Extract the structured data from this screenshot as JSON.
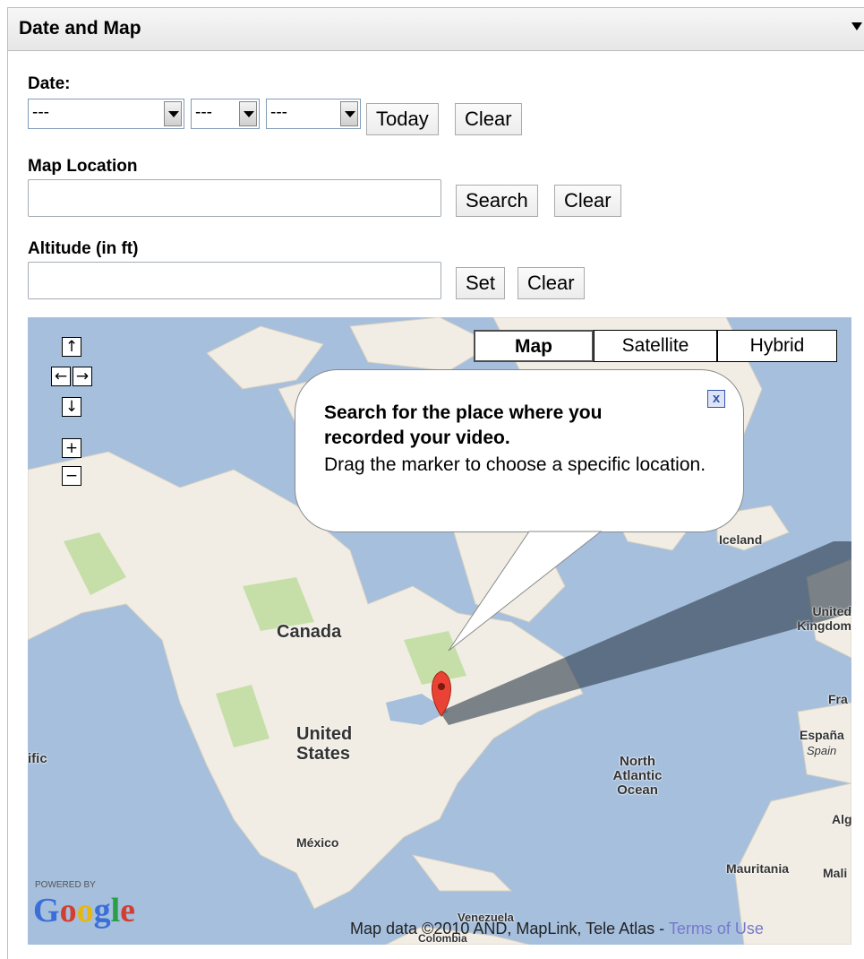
{
  "panel": {
    "title": "Date and Map"
  },
  "date": {
    "label": "Date:",
    "month": "---",
    "day": "---",
    "year": "---",
    "today_label": "Today",
    "clear_label": "Clear"
  },
  "location": {
    "label": "Map Location",
    "value": "",
    "search_label": "Search",
    "clear_label": "Clear"
  },
  "altitude": {
    "label": "Altitude (in ft)",
    "value": "",
    "set_label": "Set",
    "clear_label": "Clear"
  },
  "map": {
    "types": [
      "Map",
      "Satellite",
      "Hybrid"
    ],
    "active_type": "Map",
    "controls": {
      "up": "↑",
      "left": "←",
      "right": "→",
      "down": "↓",
      "zoom_in": "+",
      "zoom_out": "−"
    },
    "info": {
      "bold": "Search for the place where you recorded your video.",
      "text": "Drag the marker to choose a specific location.",
      "close": "x"
    },
    "labels": {
      "canada": "Canada",
      "us": "United States",
      "mexico": "México",
      "iceland": "Iceland",
      "uk": "United Kingdom",
      "france": "Fra",
      "espana": "España",
      "spain": "Spain",
      "ocean": "North Atlantic Ocean",
      "pacific": "ific",
      "alg": "Alg",
      "mauritania": "Mauritania",
      "mali": "Mali",
      "venezuela": "Venezuela",
      "colombia": "Colombia"
    },
    "powered": "POWERED BY",
    "attribution": "Map data ©2010 AND, MapLink, Tele Atlas -",
    "terms": "Terms of Use",
    "colors": {
      "water": "#a5bfdd",
      "land": "#f1ede4",
      "forest": "#c6dfa8",
      "marker": "#ea4335"
    }
  }
}
